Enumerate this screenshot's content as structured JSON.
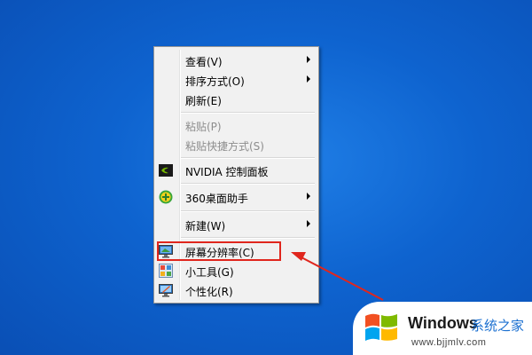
{
  "context_menu": {
    "items": [
      {
        "label": "查看(V)",
        "has_submenu": true,
        "disabled": false,
        "icon": ""
      },
      {
        "label": "排序方式(O)",
        "has_submenu": true,
        "disabled": false,
        "icon": ""
      },
      {
        "label": "刷新(E)",
        "has_submenu": false,
        "disabled": false,
        "icon": ""
      },
      {
        "label": "粘贴(P)",
        "has_submenu": false,
        "disabled": true,
        "icon": ""
      },
      {
        "label": "粘贴快捷方式(S)",
        "has_submenu": false,
        "disabled": true,
        "icon": ""
      },
      {
        "label": "NVIDIA 控制面板",
        "has_submenu": false,
        "disabled": false,
        "icon": "nvidia-icon"
      },
      {
        "label": "360桌面助手",
        "has_submenu": true,
        "disabled": false,
        "icon": "360-assistant-icon"
      },
      {
        "label": "新建(W)",
        "has_submenu": true,
        "disabled": false,
        "icon": ""
      },
      {
        "label": "屏幕分辨率(C)",
        "has_submenu": false,
        "disabled": false,
        "icon": "screen-resolution-icon",
        "highlighted": true
      },
      {
        "label": "小工具(G)",
        "has_submenu": false,
        "disabled": false,
        "icon": "gadgets-icon"
      },
      {
        "label": "个性化(R)",
        "has_submenu": false,
        "disabled": false,
        "icon": "personalize-icon"
      }
    ]
  },
  "annotation": {
    "highlight_color": "#e0261d",
    "arrow_color": "#e0261d"
  },
  "watermark": {
    "brand": "Windows",
    "suffix": "系统之家",
    "url": "www.bjjmlv.com"
  },
  "colors": {
    "desktop": "#0e63cf",
    "menu_bg": "#f1f1f1",
    "disabled_text": "#8d8d8d"
  }
}
